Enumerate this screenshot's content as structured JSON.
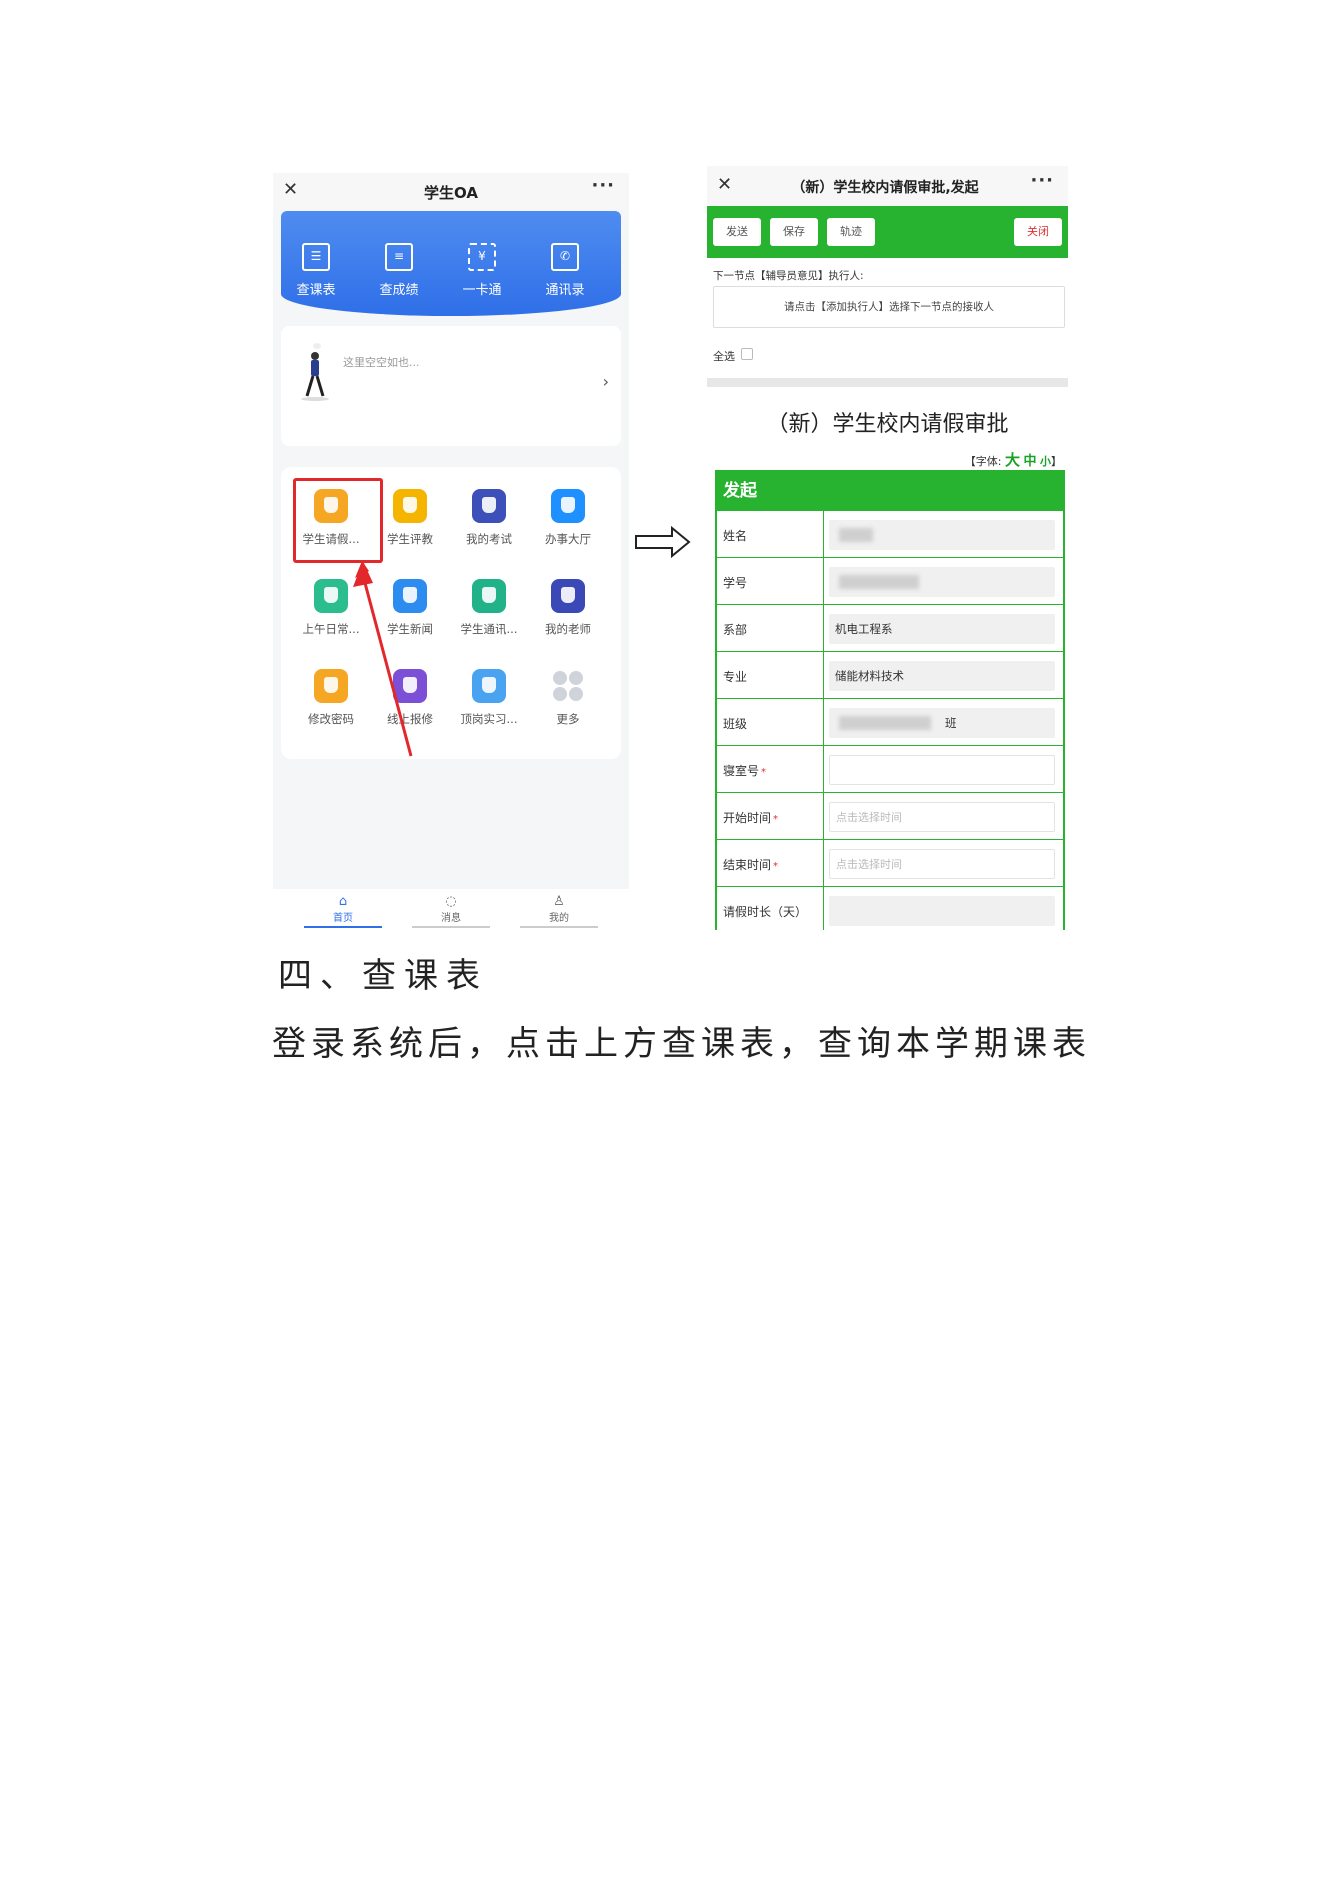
{
  "left_phone": {
    "title": "学生OA",
    "close_glyph": "✕",
    "more_glyph": "···",
    "banner_items": [
      {
        "label": "查课表",
        "icon": "calendar-icon",
        "glyph": "☰"
      },
      {
        "label": "查成绩",
        "icon": "grade-icon",
        "glyph": "≡"
      },
      {
        "label": "一卡通",
        "icon": "card-scan-icon",
        "glyph": "¥"
      },
      {
        "label": "通讯录",
        "icon": "contacts-icon",
        "glyph": "✆"
      }
    ],
    "empty_text": "这里空空如也...",
    "chevron": "›",
    "apps": [
      {
        "label": "学生请假...",
        "icon": "leave-request-icon",
        "color": "#f5a623"
      },
      {
        "label": "学生评教",
        "icon": "evaluation-icon",
        "color": "#f5b400"
      },
      {
        "label": "我的考试",
        "icon": "exam-icon",
        "color": "#3d4fb8"
      },
      {
        "label": "办事大厅",
        "icon": "service-hall-icon",
        "color": "#1e90ff"
      },
      {
        "label": "上午日常...",
        "icon": "daily-report-icon",
        "color": "#2bbd8e"
      },
      {
        "label": "学生新闻",
        "icon": "news-icon",
        "color": "#2d8cf0"
      },
      {
        "label": "学生通讯...",
        "icon": "student-contacts-icon",
        "color": "#22b28a"
      },
      {
        "label": "我的老师",
        "icon": "teacher-icon",
        "color": "#3a49b5"
      },
      {
        "label": "修改密码",
        "icon": "password-icon",
        "color": "#f5a623"
      },
      {
        "label": "线上报修",
        "icon": "repair-icon",
        "color": "#7b4fd6"
      },
      {
        "label": "顶岗实习...",
        "icon": "internship-icon",
        "color": "#4aa3f0"
      },
      {
        "label": "更多",
        "icon": "more-apps-icon",
        "color": "#cfd3da"
      }
    ],
    "tabs": [
      {
        "label": "首页",
        "icon": "home-icon",
        "glyph": "⌂"
      },
      {
        "label": "消息",
        "icon": "message-icon",
        "glyph": "◌"
      },
      {
        "label": "我的",
        "icon": "profile-icon",
        "glyph": "♙"
      }
    ],
    "highlight_color": "#e3282b"
  },
  "right_phone": {
    "title": "（新）学生校内请假审批,发起",
    "close_glyph": "✕",
    "more_glyph": "···",
    "toolbar": {
      "send": "发送",
      "save": "保存",
      "track": "轨迹",
      "close": "关闭"
    },
    "next_node_label": "下一节点【辅导员意见】执行人:",
    "next_node_hint": "请点击【添加执行人】选择下一节点的接收人",
    "select_all": "全选",
    "form_title": "（新）学生校内请假审批",
    "font_size": {
      "prefix": "【字体:",
      "large": "大",
      "medium": "中",
      "small": "小",
      "suffix": "】"
    },
    "form_header": "发起",
    "fields": [
      {
        "label": "姓名",
        "value": "",
        "required": ""
      },
      {
        "label": "学号",
        "value": "",
        "required": ""
      },
      {
        "label": "系部",
        "value": "机电工程系",
        "required": ""
      },
      {
        "label": "专业",
        "value": "储能材料技术",
        "required": ""
      },
      {
        "label": "班级",
        "value": "班",
        "required": ""
      },
      {
        "label": "寝室号",
        "value": "",
        "required": "*"
      },
      {
        "label": "开始时间",
        "value": "点击选择时间",
        "required": "*"
      },
      {
        "label": "结束时间",
        "value": "点击选择时间",
        "required": "*"
      },
      {
        "label": "请假时长（天）",
        "value": "",
        "required": ""
      }
    ],
    "accent": "#27b22f"
  },
  "document": {
    "heading": "四、查课表",
    "body": "登录系统后，点击上方查课表，查询本学期课表"
  }
}
